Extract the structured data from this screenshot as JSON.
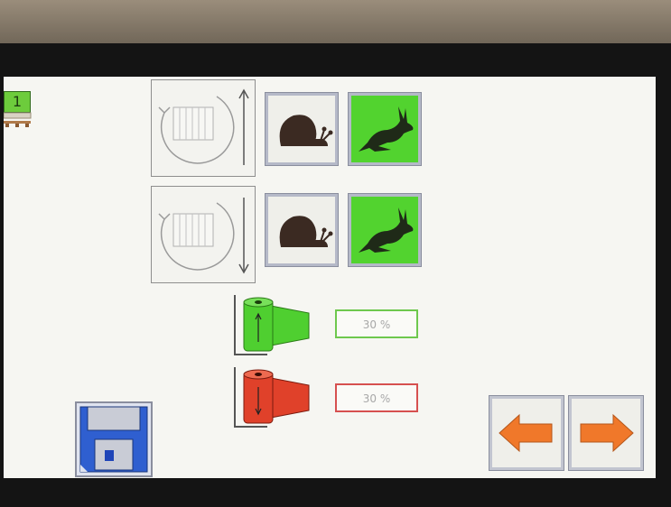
{
  "header": {
    "page_number": "1"
  },
  "rotation_up": {
    "icon": "rotate-raise-icon"
  },
  "rotation_down": {
    "icon": "rotate-lower-icon"
  },
  "speed_buttons": {
    "slow_icon": "snail-icon",
    "fast_icon": "hare-icon"
  },
  "film_tension_up": {
    "value": "30 %",
    "color": "#4fcf30"
  },
  "film_tension_down": {
    "value": "30 %",
    "color": "#e0412a"
  },
  "footer": {
    "save_icon": "floppy-disk-icon",
    "back_icon": "arrow-left-icon",
    "next_icon": "arrow-right-icon"
  },
  "colors": {
    "active": "#52d32f",
    "arrow": "#f0782a",
    "save": "#2f5fd0"
  }
}
